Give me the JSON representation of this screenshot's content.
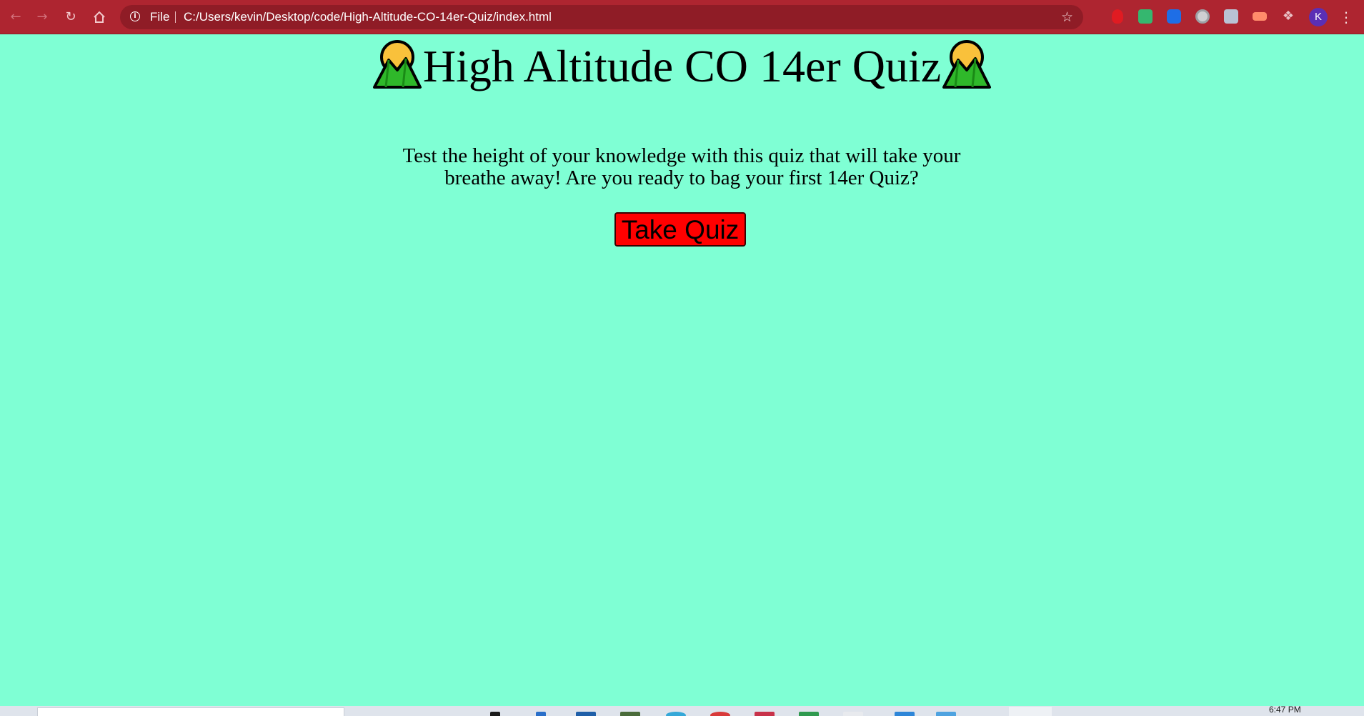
{
  "browser": {
    "nav": {
      "back_icon": "arrow-left-icon",
      "forward_icon": "arrow-right-icon",
      "reload_icon": "reload-icon",
      "home_icon": "home-icon"
    },
    "address_bar": {
      "scheme_label": "File",
      "url": "C:/Users/kevin/Desktop/code/High-Altitude-CO-14er-Quiz/index.html",
      "info_icon": "info-icon",
      "bookmark_icon": "star-icon"
    },
    "extensions": [
      "hand-stop-icon",
      "green-extension-icon",
      "blue-bookmark-extension-icon",
      "circle-extension-icon",
      "k-extension-icon",
      "orange-extension-icon",
      "puzzle-icon"
    ],
    "profile_initial": "K",
    "menu_icon": "kebab-menu-icon",
    "theme_color": "#ae2530"
  },
  "page": {
    "background_color": "#7fffd4",
    "title": "High Altitude CO 14er Quiz",
    "title_icon": "sunrise-over-mountains-icon",
    "tagline": "Test the height of your knowledge with this quiz that will take your breathe away! Are you ready to bag your first 14er Quiz?",
    "start_button_label": "Take Quiz",
    "start_button_color": "#ff0000"
  },
  "taskbar": {
    "clock": "6:47 PM"
  }
}
